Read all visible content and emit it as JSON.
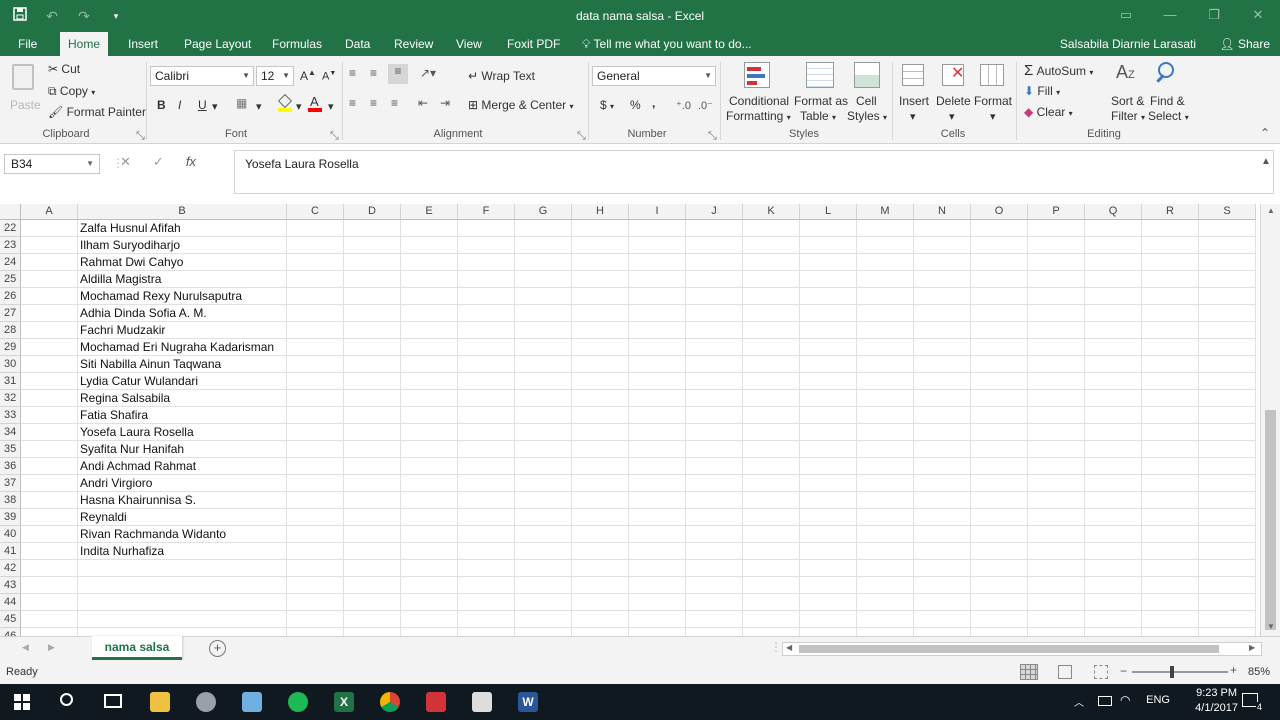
{
  "window": {
    "title": "data nama salsa - Excel",
    "qat_icons": [
      "save-icon",
      "undo-icon",
      "redo-icon",
      "customize-icon"
    ]
  },
  "ribbon_tabs": [
    "File",
    "Home",
    "Insert",
    "Page Layout",
    "Formulas",
    "Data",
    "Review",
    "View",
    "Foxit PDF"
  ],
  "active_tab": "Home",
  "tell_me": "Tell me what you want to do...",
  "user_name": "Salsabila Diarnie Larasati",
  "share_label": "Share",
  "clipboard": {
    "paste": "Paste",
    "cut": "Cut",
    "copy": "Copy",
    "format_painter": "Format Painter",
    "label": "Clipboard"
  },
  "font": {
    "name": "Calibri",
    "size": "12",
    "bold": "B",
    "italic": "I",
    "underline": "U",
    "label": "Font"
  },
  "alignment": {
    "wrap": "Wrap Text",
    "merge": "Merge & Center",
    "label": "Alignment"
  },
  "number": {
    "format": "General",
    "currency": "$",
    "percent": "%",
    "comma": ",",
    "label": "Number"
  },
  "styles": {
    "conditional": [
      "Conditional",
      "Formatting"
    ],
    "format_table": [
      "Format as",
      "Table"
    ],
    "cell_styles": [
      "Cell",
      "Styles"
    ],
    "label": "Styles"
  },
  "cells": {
    "insert": "Insert",
    "delete": "Delete",
    "format": "Format",
    "label": "Cells"
  },
  "editing": {
    "autosum": "AutoSum",
    "fill": "Fill",
    "clear": "Clear",
    "sort": [
      "Sort &",
      "Filter"
    ],
    "find": [
      "Find &",
      "Select"
    ],
    "label": "Editing"
  },
  "formula_bar": {
    "name_box": "B34",
    "fx": "fx",
    "content": "Yosefa Laura Rosella"
  },
  "columns": [
    "A",
    "B",
    "C",
    "D",
    "E",
    "F",
    "G",
    "H",
    "I",
    "J",
    "K",
    "L",
    "M",
    "N",
    "O",
    "P",
    "Q",
    "R",
    "S"
  ],
  "rows": [
    {
      "num": "22",
      "b": "Zalfa Husnul Afifah"
    },
    {
      "num": "23",
      "b": "Ilham Suryodiharjo"
    },
    {
      "num": "24",
      "b": "Rahmat Dwi Cahyo"
    },
    {
      "num": "25",
      "b": "Aldilla Magistra"
    },
    {
      "num": "26",
      "b": "Mochamad Rexy Nurulsaputra"
    },
    {
      "num": "27",
      "b": "Adhia Dinda Sofia A. M."
    },
    {
      "num": "28",
      "b": "Fachri Mudzakir"
    },
    {
      "num": "29",
      "b": "Mochamad Eri Nugraha Kadarisman"
    },
    {
      "num": "30",
      "b": "Siti Nabilla Ainun Taqwana"
    },
    {
      "num": "31",
      "b": "Lydia Catur Wulandari"
    },
    {
      "num": "32",
      "b": "Regina Salsabila"
    },
    {
      "num": "33",
      "b": "Fatia Shafira"
    },
    {
      "num": "34",
      "b": "Yosefa Laura Rosella"
    },
    {
      "num": "35",
      "b": "Syafita Nur Hanifah"
    },
    {
      "num": "36",
      "b": "Andi Achmad Rahmat"
    },
    {
      "num": "37",
      "b": "Andri Virgioro"
    },
    {
      "num": "38",
      "b": "Hasna Khairunnisa S."
    },
    {
      "num": "39",
      "b": "Reynaldi"
    },
    {
      "num": "40",
      "b": "Rivan Rachmanda Widanto"
    },
    {
      "num": "41",
      "b": "Indita Nurhafiza"
    },
    {
      "num": "42",
      "b": ""
    },
    {
      "num": "43",
      "b": ""
    },
    {
      "num": "44",
      "b": ""
    },
    {
      "num": "45",
      "b": ""
    },
    {
      "num": "46",
      "b": ""
    }
  ],
  "sheet_tab": "nama salsa",
  "status": {
    "ready": "Ready",
    "zoom": "85%"
  },
  "taskbar": {
    "time": "9:23 PM",
    "date": "4/1/2017",
    "lang": "ENG",
    "notifications": "4"
  },
  "colors": {
    "excel_green": "#217346"
  }
}
